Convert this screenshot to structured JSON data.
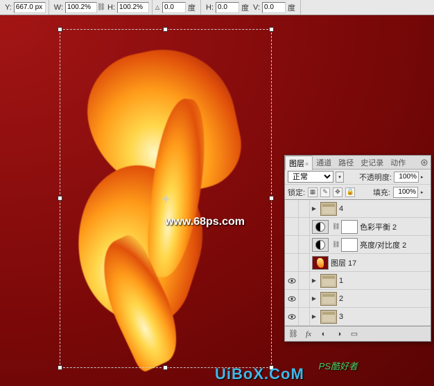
{
  "options": {
    "y_label": "Y:",
    "y_value": "667.0 px",
    "w_label": "W:",
    "w_value": "100.2%",
    "h_label": "H:",
    "h_value": "100.2%",
    "angle_value": "0.0",
    "angle_unit": "度",
    "skew_h_label": "H:",
    "skew_h_value": "0.0",
    "skew_h_unit": "度",
    "skew_v_label": "V:",
    "skew_v_value": "0.0",
    "skew_v_unit": "度"
  },
  "watermarks": {
    "url1": "www.68ps.com",
    "logo": "PS酷好者",
    "url2": "UiBoX.CoM"
  },
  "panel": {
    "tabs": {
      "layers": "图层",
      "channels": "通道",
      "paths": "路径",
      "history": "史记录",
      "actions": "动作"
    },
    "blend_mode": "正常",
    "opacity_label": "不透明度:",
    "opacity_value": "100%",
    "lock_label": "锁定:",
    "fill_label": "填充:",
    "fill_value": "100%",
    "layers": [
      {
        "name": "4"
      },
      {
        "name": "色彩平衡 2"
      },
      {
        "name": "亮度/对比度 2"
      },
      {
        "name": "图层 17"
      },
      {
        "name": "1"
      },
      {
        "name": "2"
      },
      {
        "name": "3"
      }
    ]
  }
}
